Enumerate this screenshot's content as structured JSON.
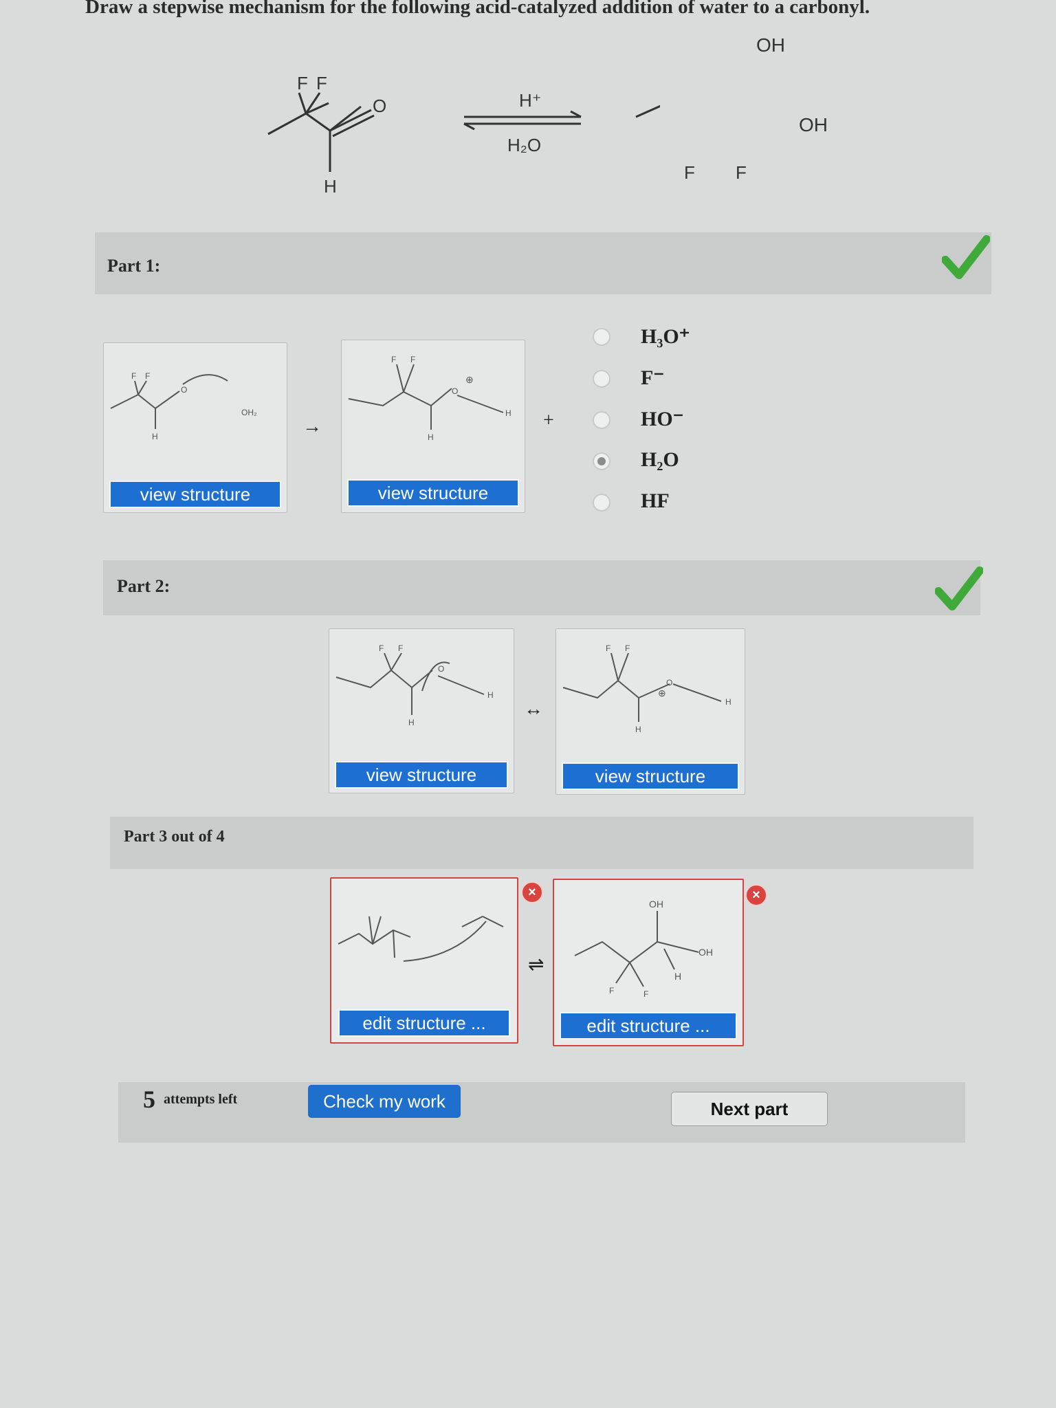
{
  "question": "Draw a stepwise mechanism for the following acid-catalyzed addition of water to a carbonyl.",
  "reaction": {
    "reactant_labels": {
      "f1": "F",
      "f2": "F",
      "o": "O",
      "h": "H"
    },
    "reagent_top": "H⁺",
    "reagent_bottom": "H₂O",
    "product_labels": {
      "oh1": "OH",
      "oh2": "OH",
      "f1": "F",
      "f2": "F"
    }
  },
  "part1": {
    "label": "Part 1:",
    "arrow": "→",
    "plus": "+",
    "box1_button": "view structure",
    "box2_button": "view structure",
    "box1_labels": {
      "f1": "F",
      "f2": "F",
      "h": "H",
      "o": "O",
      "oh2": "OH₂"
    },
    "box2_labels": {
      "f1": "F",
      "f2": "F",
      "h": "H",
      "o": "O",
      "h2": "H",
      "charge": "⊕"
    },
    "options": [
      {
        "label": "H₃O⁺",
        "selected": false
      },
      {
        "label": "F⁻",
        "selected": false
      },
      {
        "label": "HO⁻",
        "selected": false
      },
      {
        "label": "H₂O",
        "selected": true
      },
      {
        "label": "HF",
        "selected": false
      }
    ]
  },
  "part2": {
    "label": "Part 2:",
    "arrow": "↔",
    "box1_button": "view structure",
    "box2_button": "view structure",
    "box1_labels": {
      "f1": "F",
      "f2": "F",
      "h": "H",
      "o": "O",
      "h2": "H"
    },
    "box2_labels": {
      "f1": "F",
      "f2": "F",
      "h": "H",
      "o": "O",
      "h2": "H",
      "charge": "⊕"
    }
  },
  "part3": {
    "label": "Part 3 out of 4",
    "arrow": "⇌",
    "box1_button": "edit structure ...",
    "box2_button": "edit structure ...",
    "box2_labels": {
      "oh1": "OH",
      "oh2": "OH",
      "h": "H",
      "f1": "F",
      "f2": "F"
    },
    "x_mark": "×"
  },
  "footer": {
    "attempts_number": "5",
    "attempts_text": "attempts left",
    "check_button": "Check my work",
    "next_button": "Next part"
  },
  "colors": {
    "accent": "#1d6fd1",
    "check": "#3fa93a",
    "error": "#d94440"
  }
}
